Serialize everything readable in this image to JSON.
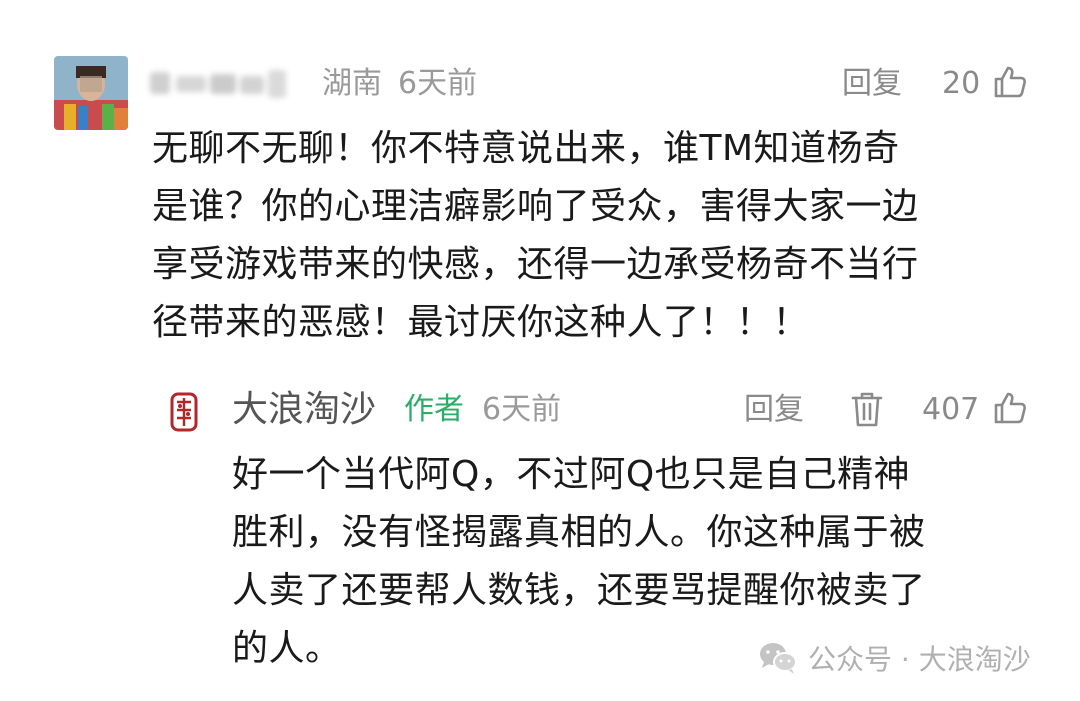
{
  "comment": {
    "region": "湖南",
    "time": "6天前",
    "reply_label": "回复",
    "like_count": "20",
    "text_lines": [
      "无聊不无聊！你不特意说出来，谁TM知道杨奇",
      "是谁？你的心理洁癖影响了受众，害得大家一边",
      "享受游戏带来的快感，还得一边承受杨奇不当行",
      "径带来的恶感！最讨厌你这种人了！！！"
    ]
  },
  "reply": {
    "author_name": "大浪淘沙",
    "author_badge": "作者",
    "time": "6天前",
    "reply_label": "回复",
    "like_count": "407",
    "text_lines": [
      "好一个当代阿Q，不过阿Q也只是自己精神",
      "胜利，没有怪揭露真相的人。你这种属于被",
      "人卖了还要帮人数钱，还要骂提醒你被卖了",
      "的人。"
    ]
  },
  "watermark": {
    "text": "公众号 · 大浪淘沙"
  },
  "icons": {
    "like": "thumbs-up-icon",
    "delete": "trash-icon",
    "watermark": "wechat-icon"
  },
  "colors": {
    "author_badge": "#2aae67",
    "meta_text": "#9a9a9a",
    "body_text": "#1a1a1a"
  }
}
